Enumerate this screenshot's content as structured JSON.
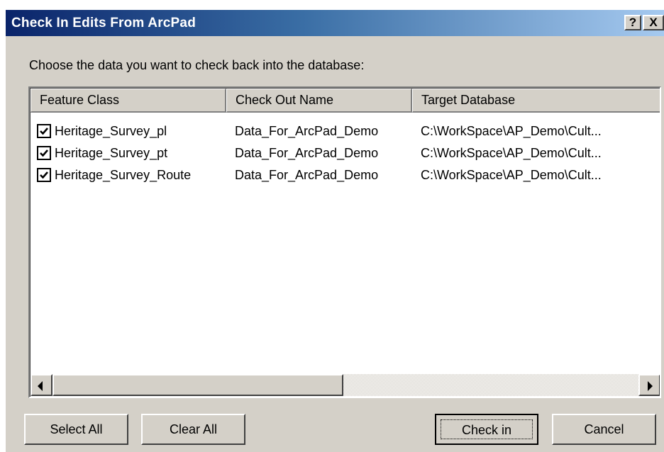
{
  "window": {
    "title": "Check In Edits From ArcPad",
    "help_label": "?",
    "close_label": "X"
  },
  "instruction": "Choose the data you want to check back into the database:",
  "table": {
    "columns": [
      "Feature Class",
      "Check Out Name",
      "Target Database"
    ],
    "rows": [
      {
        "checked": true,
        "feature_class": "Heritage_Survey_pl",
        "check_out_name": "Data_For_ArcPad_Demo",
        "target_database": "C:\\WorkSpace\\AP_Demo\\Cult..."
      },
      {
        "checked": true,
        "feature_class": "Heritage_Survey_pt",
        "check_out_name": "Data_For_ArcPad_Demo",
        "target_database": "C:\\WorkSpace\\AP_Demo\\Cult..."
      },
      {
        "checked": true,
        "feature_class": "Heritage_Survey_Route",
        "check_out_name": "Data_For_ArcPad_Demo",
        "target_database": "C:\\WorkSpace\\AP_Demo\\Cult..."
      }
    ]
  },
  "buttons": {
    "select_all": "Select All",
    "clear_all": "Clear All",
    "check_in": "Check in",
    "cancel": "Cancel"
  },
  "icons": {
    "checkmark": "checkmark-icon",
    "scroll_left": "arrow-left-icon",
    "scroll_right": "arrow-right-icon"
  }
}
